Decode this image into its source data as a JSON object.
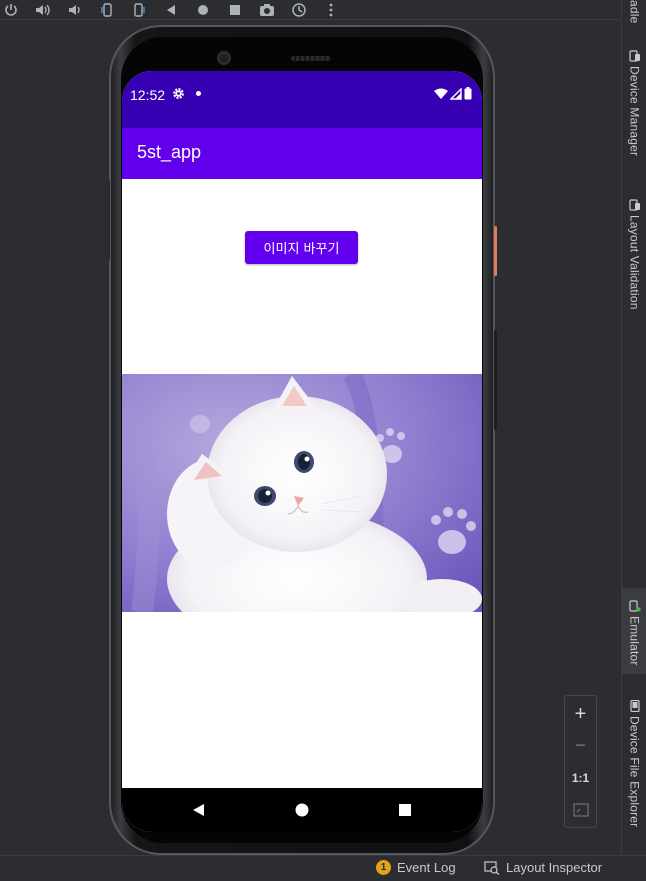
{
  "ide": {
    "right_tabs": {
      "gradle": "adle",
      "device_manager": "Device Manager",
      "layout_validation": "Layout Validation",
      "emulator": "Emulator",
      "device_file_explorer": "Device File Explorer"
    },
    "zoom": {
      "zoom_in": "+",
      "zoom_out": "−",
      "actual_size": "1:1"
    },
    "bottom": {
      "event_log_count": "1",
      "event_log": "Event Log",
      "layout_inspector": "Layout Inspector"
    },
    "toolbar_icons": [
      "power-icon",
      "volume-up-icon",
      "volume-down-icon",
      "rotate-left-icon",
      "rotate-right-icon",
      "back-icon",
      "home-icon",
      "overview-icon",
      "camera-icon",
      "snapshot-icon",
      "more-icon"
    ]
  },
  "device": {
    "status_bar": {
      "time": "12:52",
      "icons": [
        "settings-icon",
        "notification-dot-icon",
        "wifi-icon",
        "signal-icon",
        "battery-icon"
      ]
    },
    "app_bar": {
      "title": "5st_app"
    },
    "content": {
      "change_image_button": "이미지 바꾸기",
      "image": "white-kitten-on-purple-blanket"
    },
    "nav_bar": {
      "icons": [
        "back-icon",
        "home-icon",
        "recents-icon"
      ]
    }
  },
  "colors": {
    "status_bar": "#3700b3",
    "app_bar": "#6200ee",
    "button": "#6200ee",
    "ide_background": "#2b2d30",
    "event_badge": "#e3a21a"
  }
}
